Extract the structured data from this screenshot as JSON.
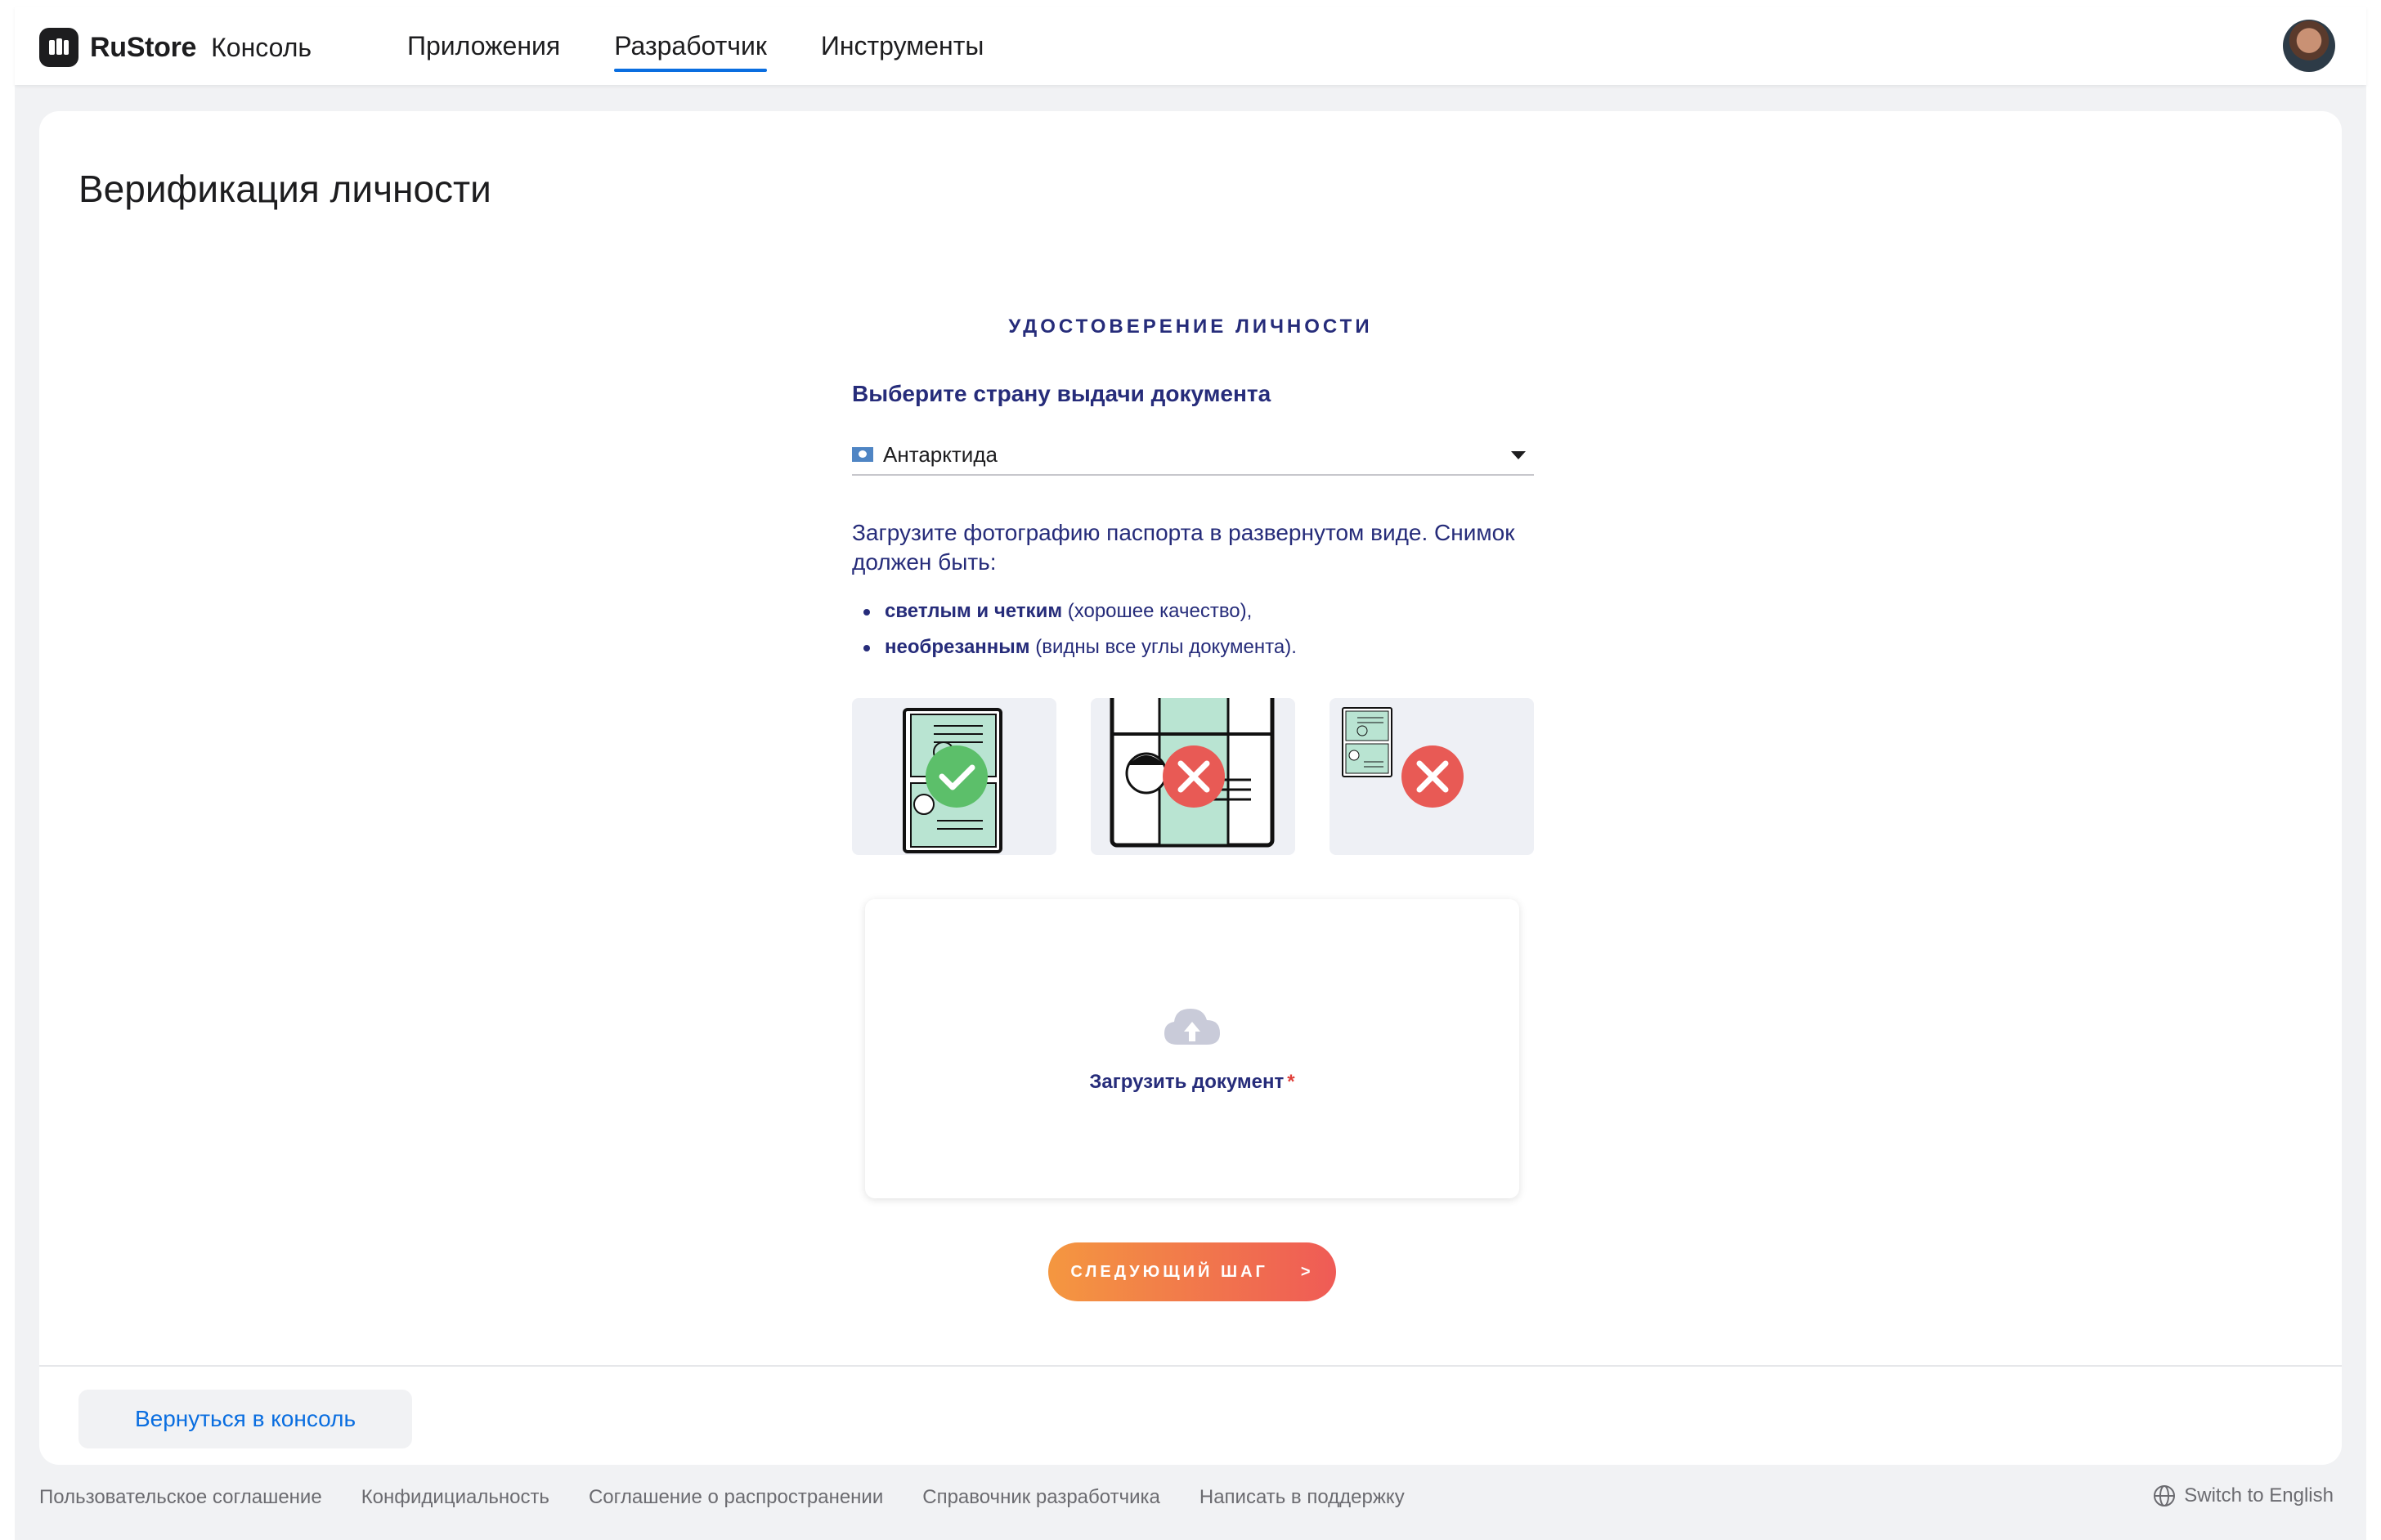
{
  "header": {
    "brand_name": "RuStore",
    "brand_sub": "Консоль",
    "nav": [
      {
        "label": "Приложения",
        "active": false
      },
      {
        "label": "Разработчик",
        "active": true
      },
      {
        "label": "Инструменты",
        "active": false
      }
    ],
    "logo_icon": "rustore-logo-icon",
    "avatar_icon": "user-avatar"
  },
  "page": {
    "title": "Верификация личности",
    "section_title": "УДОСТОВЕРЕНИЕ ЛИЧНОСТИ",
    "country_label": "Выберите страну выдачи документа",
    "country_value": "Антарктида",
    "instructions": "Загрузите фотографию паспорта в развернутом виде. Снимок должен быть:",
    "bullets": [
      {
        "strong": "светлым и четким",
        "rest": " (хорошее качество),"
      },
      {
        "strong": "необрезанным",
        "rest": " (видны все углы документа)."
      }
    ],
    "examples": [
      {
        "status": "correct",
        "icon": "check-icon"
      },
      {
        "status": "too-close",
        "icon": "cross-icon"
      },
      {
        "status": "too-small",
        "icon": "cross-icon"
      }
    ],
    "upload_label": "Загрузить документ",
    "upload_required_mark": "*",
    "next_button": "СЛЕДУЮЩИЙ ШАГ",
    "next_arrow": ">",
    "back_button": "Вернуться в консоль"
  },
  "footer": {
    "links": [
      "Пользовательское соглашение",
      "Конфидициальность",
      "Соглашение о распространении",
      "Справочник разработчика",
      "Написать в поддержку"
    ],
    "lang_switch": "Switch to English"
  },
  "colors": {
    "accent_blue": "#0a6ee0",
    "navy_text": "#262c7a",
    "gradient_start": "#f49740",
    "gradient_end": "#ef5b56",
    "success": "#5cbf6a",
    "error": "#e85a55"
  }
}
